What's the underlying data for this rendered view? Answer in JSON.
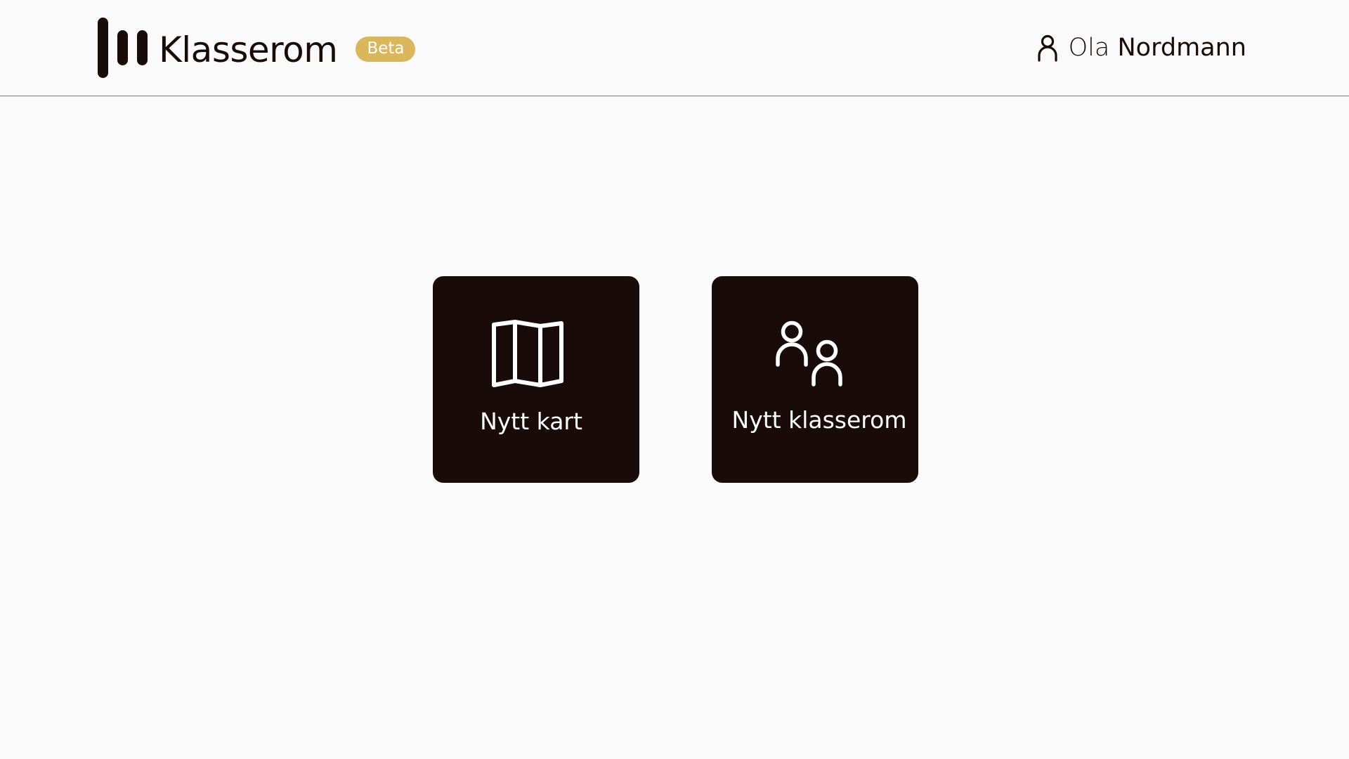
{
  "header": {
    "app_name": "Klasserom",
    "badge": "Beta",
    "user": {
      "first_name": "Ola",
      "last_name": "Nordmann",
      "icon": "user-icon"
    }
  },
  "actions": [
    {
      "label": "Nytt kart",
      "icon": "map-icon"
    },
    {
      "label": "Nytt klasserom",
      "icon": "people-icon"
    }
  ],
  "colors": {
    "background": "#fafafa",
    "primary": "#1a0b0b",
    "badge": "#dbb75c",
    "card_text": "#ffffff"
  }
}
